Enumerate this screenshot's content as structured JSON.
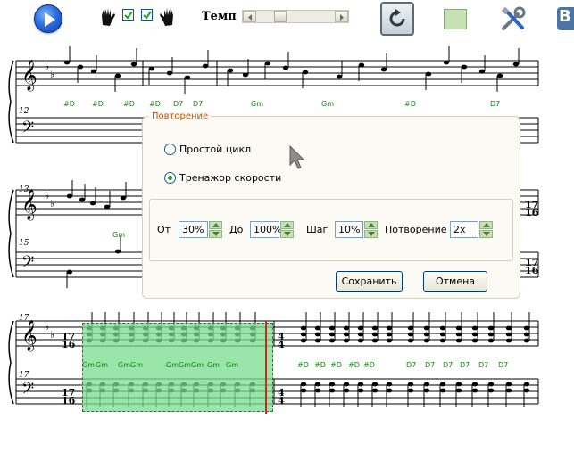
{
  "toolbar": {
    "play_icon": "play-icon",
    "left_hand_icon": "left-hand-icon",
    "left_hand_checked": true,
    "right_hand_checked": true,
    "right_hand_icon": "right-hand-icon",
    "tempo_label": "Темп",
    "loop_icon": "loop-icon",
    "settings_icon": "tools-icon",
    "vk_label": "В"
  },
  "score": {
    "measure_numbers": [
      "12",
      "13",
      "15",
      "17",
      "17"
    ],
    "time_sig_1": [
      "17",
      "16"
    ],
    "time_sig_2": [
      "4",
      "4"
    ],
    "chords_row1": [
      "#D",
      "#D",
      "#D",
      "#D",
      "D7",
      "D7",
      "Gm",
      "Gm",
      "#D",
      "D7"
    ],
    "chords_row2": [
      "Gm"
    ],
    "chords_row3": [
      "Gm",
      "Gm",
      "Gm",
      "Gm",
      "Gm",
      "Gm",
      "Gm",
      "Gm",
      "Gm",
      "#D",
      "#D",
      "#D",
      "#D",
      "#D",
      "D7",
      "D7",
      "D7",
      "D7",
      "D7",
      "D7"
    ]
  },
  "dialog": {
    "group_title": "Повторение",
    "option_simple": "Простой цикл",
    "option_speed": "Тренажор скорости",
    "selected_option": "speed",
    "from_label": "От",
    "from_value": "30%",
    "to_label": "До",
    "to_value": "100%",
    "step_label": "Шаг",
    "step_value": "10%",
    "repeat_label": "Потворение",
    "repeat_value": "2x",
    "save_button": "Сохранить",
    "cancel_button": "Отмена"
  },
  "colors": {
    "chord_text": "#0a8a0a",
    "selection": "#7ddc8c",
    "dialog_title": "#c2530f"
  }
}
